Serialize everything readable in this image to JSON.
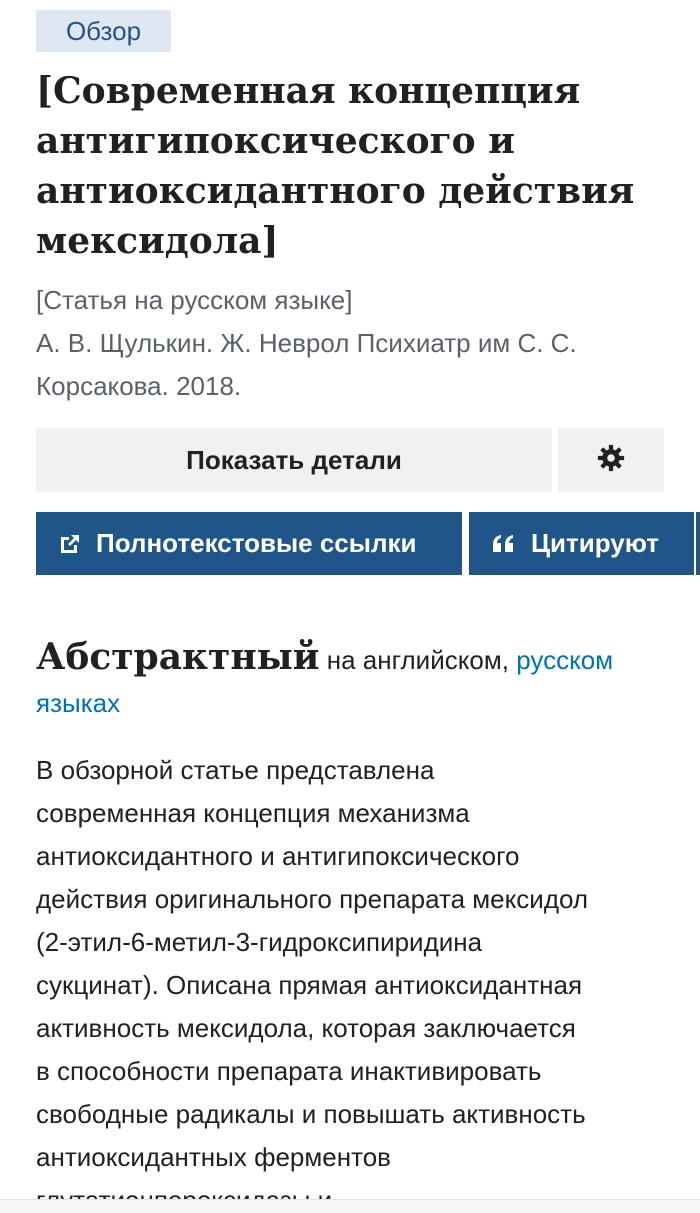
{
  "badge": {
    "label": "Обзор"
  },
  "article": {
    "title_lines": [
      "[Современная концепция",
      "антигипоксического и",
      "антиоксидантного действия",
      "мексидола]"
    ],
    "language_note": "[Статья на русском языке]",
    "citation_lines": [
      "А. В. Щулькин. Ж. Неврол Психиатр им С. С.",
      "Корсакова. 2018."
    ]
  },
  "actions": {
    "details_label": "Показать детали",
    "settings_icon": "gear-icon",
    "fulltext_label": "Полнотекстовые ссылки",
    "fulltext_icon": "external-link-icon",
    "cite_label": "Цитируют",
    "cite_icon": "quote-icon",
    "accent_color": "#20558a"
  },
  "abstract": {
    "heading": "Абстрактный",
    "lang_text": "на английском,",
    "lang_link_1": "русском",
    "lang_link_2": "языках",
    "link_color": "#0071bc",
    "lines": [
      "В обзорной статье представлена",
      "современная концепция механизма",
      "антиоксидантного и антигипоксического",
      "действия оригинального препарата мексидол",
      "(2-этил-6-метил-3-гидроксипиридина",
      "сукцинат). Описана прямая антиоксидантная",
      "активность мексидола, которая заключается",
      "в способности препарата инактивировать",
      "свободные радикалы и повышать активность",
      "антиоксидантных ферментов",
      "глутатионпероксидазы и"
    ]
  }
}
